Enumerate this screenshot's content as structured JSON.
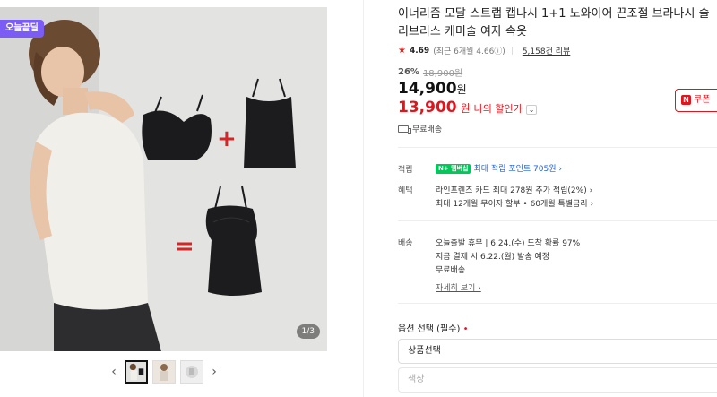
{
  "gallery": {
    "badge": "오늘끝딜",
    "page_indicator": "1/3",
    "plus_sign": "+",
    "equals_sign": "=",
    "prev_arrow": "‹",
    "next_arrow": "›",
    "thumbnail_count": 3
  },
  "product": {
    "title": "이너리즘 모달 스트랩 캡나시 1+1 노와이어 끈조절 브라나시 슬리브리스 캐미솔 여자 속옷",
    "rating": {
      "star": "★",
      "value": "4.69",
      "recent": "(최근 6개월 4.66ⓘ)",
      "reviews": "5,158건 리뷰"
    },
    "discount_rate": "26%",
    "original_price": "18,900원",
    "price": "14,900",
    "price_unit": "원",
    "sale_price": "13,900",
    "sale_unit": "원",
    "my_discount": "나의 할인가",
    "coupon_label": "쿠폰",
    "free_shipping": "무료배송"
  },
  "info": {
    "points_label": "적립",
    "points_badge": "N+ 멤버십",
    "points_text": "최대 적립 포인트 705원 ›",
    "benefit_label": "혜택",
    "benefit_lines": [
      "라인프렌즈 카드 최대 278원 추가 적립(2%) ›",
      "최대 12개월 무이자 할부 • 60개월 특별금리 ›"
    ],
    "delivery_label": "배송",
    "delivery_lines": [
      "오늘출발 휴무 | 6.24.(수) 도착 확률 97%",
      "지금 결제 시 6.22.(월) 발송 예정",
      "무료배송"
    ],
    "detail_link": "자세히 보기 ›"
  },
  "options": {
    "label": "옵션 선택 (필수)",
    "required_mark": "•",
    "product_select": "상품선택",
    "color_select": "색상"
  },
  "colors": {
    "accent_red": "#e2141c",
    "badge_purple": "#7b5cf5",
    "npay_green": "#03c75a"
  }
}
